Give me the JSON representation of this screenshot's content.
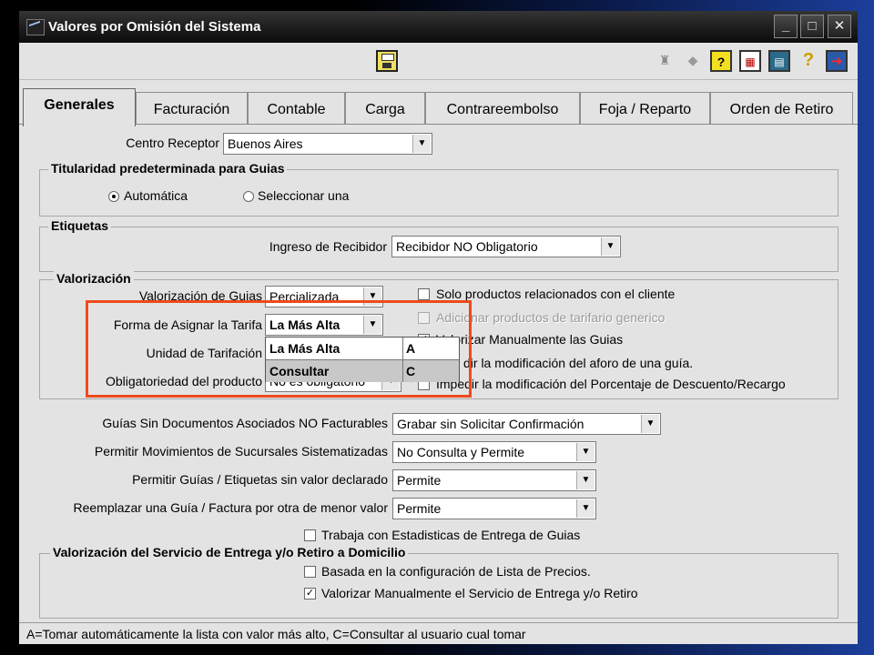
{
  "window": {
    "title": "Valores por Omisión del Sistema"
  },
  "toolbar": {
    "icons": [
      "save-icon",
      "binoculars-icon",
      "tag-icon",
      "help-question-icon",
      "grid-icon",
      "calculator-icon",
      "question-icon",
      "exit-icon"
    ]
  },
  "tabs": [
    "Generales",
    "Facturación",
    "Contable",
    "Carga",
    "Contrareembolso",
    "Foja / Reparto",
    "Orden de Retiro"
  ],
  "general": {
    "centro_receptor_label": "Centro Receptor",
    "centro_receptor_value": "Buenos Aires",
    "titularidad": {
      "title": "Titularidad predeterminada para Guias",
      "options": [
        "Automática",
        "Seleccionar una"
      ],
      "selected": "Automática"
    },
    "etiquetas": {
      "title": "Etiquetas",
      "ingreso_label": "Ingreso de Recibidor",
      "ingreso_value": "Recibidor NO Obligatorio"
    },
    "valorizacion": {
      "title": "Valorización",
      "valorizacion_guias_label": "Valorización de Guias",
      "valorizacion_guias_value": "Percializada",
      "forma_label": "Forma de Asignar la Tarifa",
      "forma_value": "La Más Alta",
      "unidad_label": "Unidad de Tarifación",
      "obligatoriedad_label": "Obligatoriedad del producto",
      "obligatoriedad_value": "No es obligatorio",
      "checks": [
        {
          "label": "Solo productos relacionados con el cliente",
          "checked": false
        },
        {
          "label": "Adicionar productos de tarifario generico",
          "checked": false,
          "disabled": true
        },
        {
          "label": "Valorizar Manualmente las Guias",
          "checked": true
        },
        {
          "label": "dir la modificación del aforo de una guía.",
          "checked": false
        },
        {
          "label": "Impedir la modificación del Porcentaje de Descuento/Recargo",
          "checked": false
        }
      ]
    },
    "dropdown": {
      "options": [
        {
          "name": "La Más Alta",
          "code": "A"
        },
        {
          "name": "Consultar",
          "code": "C"
        }
      ]
    },
    "guias_sin_doc_label": "Guías Sin Documentos Asociados NO Facturables",
    "guias_sin_doc_value": "Grabar sin Solicitar Confirmación",
    "permitir_mov_label": "Permitir Movimientos de Sucursales Sistematizadas",
    "permitir_mov_value": "No Consulta y Permite",
    "permitir_guias_label": "Permitir Guías / Etiquetas sin valor declarado",
    "permitir_guias_value": "Permite",
    "reemplazar_label": "Reemplazar una Guía / Factura por otra de menor valor",
    "reemplazar_value": "Permite",
    "estadisticas_label": "Trabaja con Estadisticas de Entrega de Guias",
    "servicio": {
      "title": "Valorización del Servicio de Entrega y/o Retiro a Domicilio",
      "check1": "Basada en la configuración de Lista de Precios.",
      "check2": "Valorizar Manualmente el Servicio de Entrega y/o Retiro"
    }
  },
  "status_text": "A=Tomar automáticamente la lista con valor más alto, C=Consultar al usuario cual tomar"
}
